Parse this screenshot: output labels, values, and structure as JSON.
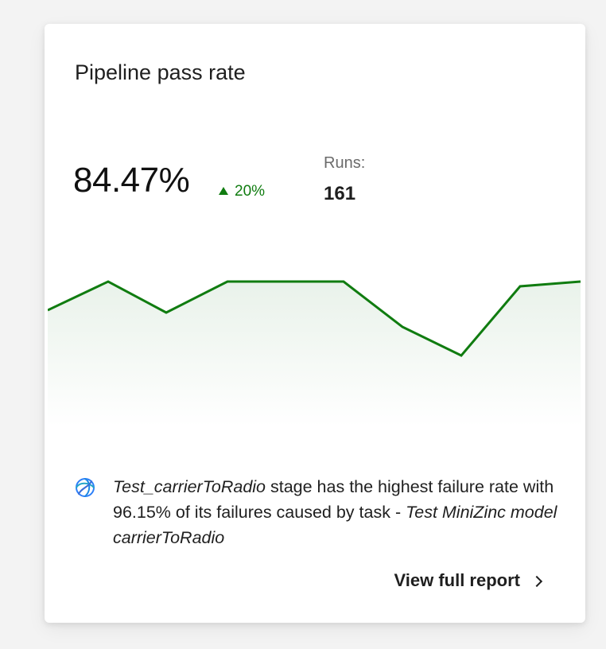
{
  "card": {
    "title": "Pipeline pass rate",
    "metric": "84.47%",
    "trend": {
      "direction": "up",
      "value": "20%",
      "color": "#107c10"
    },
    "runs": {
      "label": "Runs:",
      "value": "161"
    }
  },
  "chart_data": {
    "type": "area",
    "line_color": "#107c10",
    "values": [
      88,
      100,
      87,
      100,
      100,
      100,
      81,
      69,
      98,
      100
    ]
  },
  "insight": {
    "icon": "copilot-swirl-icon",
    "stage_name": "Test_carrierToRadio",
    "text_main": " stage has the highest failure rate with 96.15% of its failures caused by task - ",
    "task_name": "Test MiniZinc model carrierToRadio"
  },
  "report_link": {
    "label": "View full report",
    "icon": "chevron-right-icon"
  }
}
